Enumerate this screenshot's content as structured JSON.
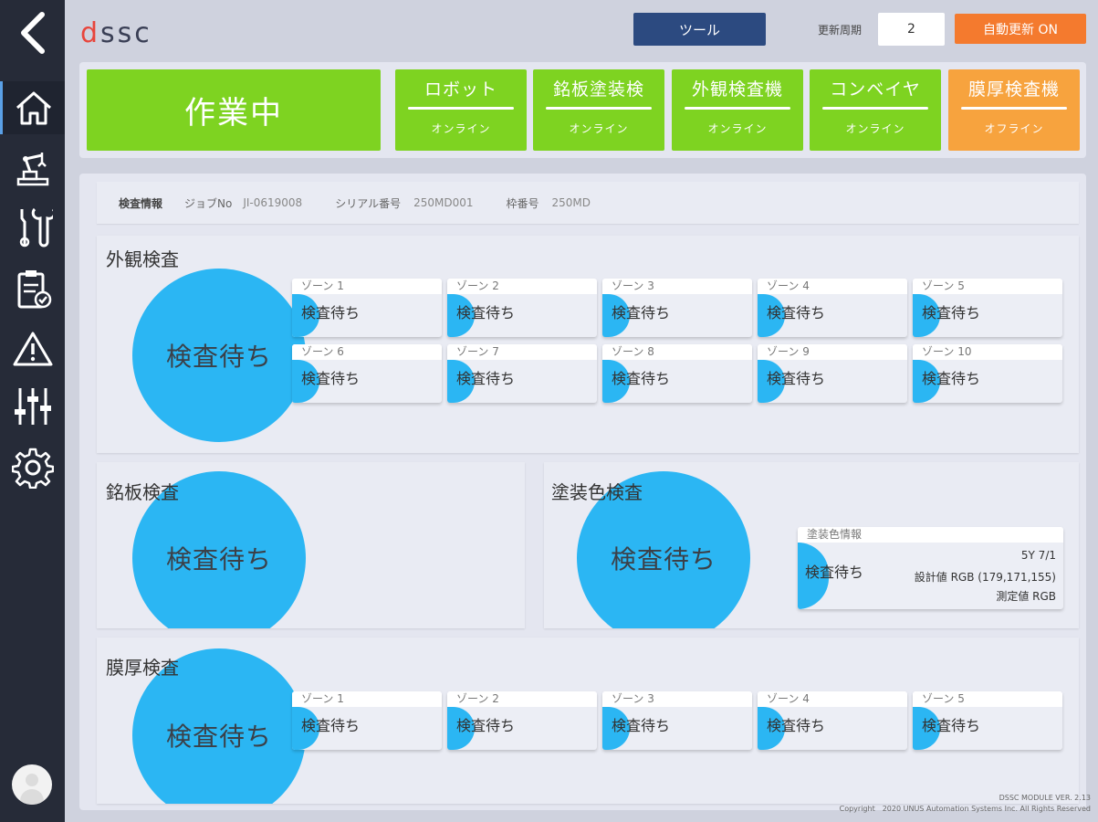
{
  "app": {
    "logo": "dssc"
  },
  "header": {
    "tool_label": "ツール",
    "refresh_label": "更新周期",
    "refresh_value": "2",
    "auto_refresh_label": "自動更新 ON"
  },
  "status": {
    "main": "作業中",
    "machines": [
      {
        "name": "ロボット",
        "status": "オンライン",
        "color": "#7ed321"
      },
      {
        "name": "銘板塗装検",
        "status": "オンライン",
        "color": "#7ed321"
      },
      {
        "name": "外観検査機",
        "status": "オンライン",
        "color": "#7ed321"
      },
      {
        "name": "コンベイヤ",
        "status": "オンライン",
        "color": "#7ed321"
      },
      {
        "name": "膜厚検査機",
        "status": "オフライン",
        "color": "#f7a33e"
      }
    ]
  },
  "inspection_info": {
    "title": "検査情報",
    "job_label": "ジョブNo",
    "job_value": "JI-0619008",
    "serial_label": "シリアル番号",
    "serial_value": "250MD001",
    "frame_label": "枠番号",
    "frame_value": "250MD"
  },
  "appearance": {
    "title": "外観検査",
    "status": "検査待ち",
    "zones": [
      {
        "label": "ゾーン 1",
        "status": "検査待ち"
      },
      {
        "label": "ゾーン 2",
        "status": "検査待ち"
      },
      {
        "label": "ゾーン 3",
        "status": "検査待ち"
      },
      {
        "label": "ゾーン 4",
        "status": "検査待ち"
      },
      {
        "label": "ゾーン 5",
        "status": "検査待ち"
      },
      {
        "label": "ゾーン 6",
        "status": "検査待ち"
      },
      {
        "label": "ゾーン 7",
        "status": "検査待ち"
      },
      {
        "label": "ゾーン 8",
        "status": "検査待ち"
      },
      {
        "label": "ゾーン 9",
        "status": "検査待ち"
      },
      {
        "label": "ゾーン 10",
        "status": "検査待ち"
      }
    ]
  },
  "nameplate": {
    "title": "銘板検査",
    "status": "検査待ち"
  },
  "paint": {
    "title": "塗装色検査",
    "status": "検査待ち",
    "card_title": "塗装色情報",
    "card_status": "検査待ち",
    "color_code": "5Y 7/1",
    "design_value": "設計値 RGB (179,171,155)",
    "measured_value": "測定値 RGB"
  },
  "thickness": {
    "title": "膜厚検査",
    "status": "検査待ち",
    "zones": [
      {
        "label": "ゾーン 1",
        "status": "検査待ち"
      },
      {
        "label": "ゾーン 2",
        "status": "検査待ち"
      },
      {
        "label": "ゾーン 3",
        "status": "検査待ち"
      },
      {
        "label": "ゾーン 4",
        "status": "検査待ち"
      },
      {
        "label": "ゾーン 5",
        "status": "検査待ち"
      }
    ]
  },
  "footer": {
    "version": "DSSC MODULE VER. 2.13",
    "copyright": "Copyright　2020 UNUS Automation Systems Inc. All Rights Reserved"
  },
  "colors": {
    "accent_blue": "#2bb6f3",
    "online": "#7ed321",
    "offline": "#f7a33e",
    "sidebar": "#262b38"
  }
}
